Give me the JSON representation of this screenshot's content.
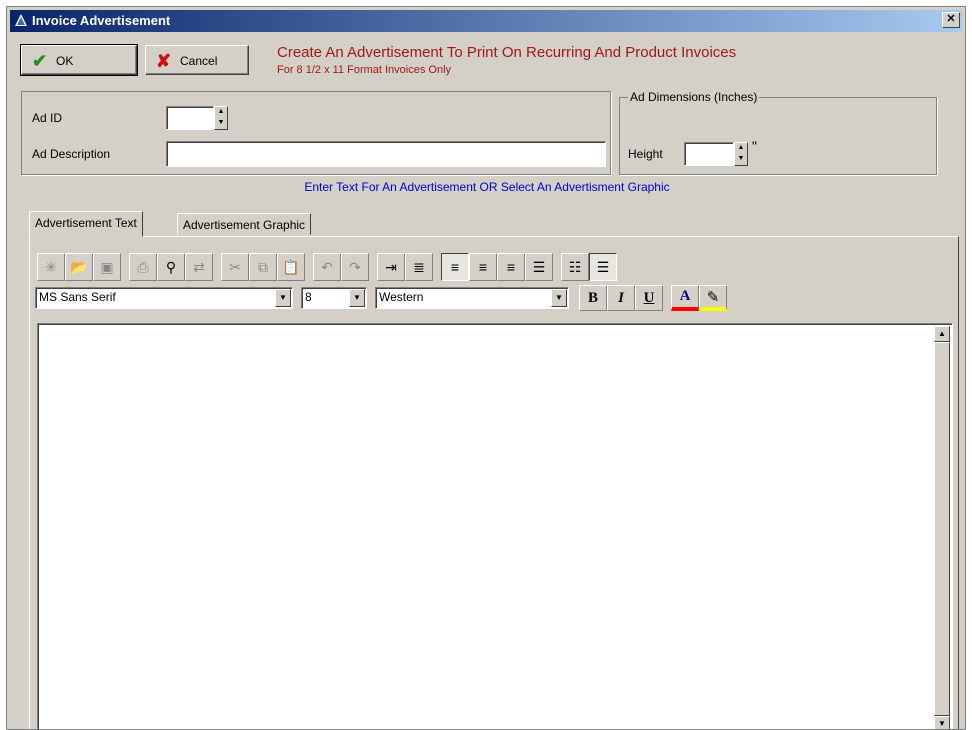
{
  "window": {
    "title": "Invoice Advertisement",
    "close_glyph": "✕"
  },
  "buttons": {
    "ok": "OK",
    "cancel": "Cancel"
  },
  "header": {
    "headline": "Create An Advertisement To Print On Recurring And Product Invoices",
    "subline": "For 8 1/2 x 11 Format Invoices Only"
  },
  "form": {
    "ad_id_label": "Ad ID",
    "ad_id_value": "",
    "ad_description_label": "Ad Description",
    "ad_description_value": "",
    "dimensions_legend": "Ad Dimensions (Inches)",
    "height_label": "Height",
    "height_value": "",
    "height_unit": "\""
  },
  "info_text": "Enter Text For An Advertisement OR Select An Advertisment Graphic",
  "tabs": [
    {
      "label": "Advertisement Text",
      "active": true
    },
    {
      "label": "Advertisement Graphic",
      "active": false
    }
  ],
  "toolbar": {
    "icons": [
      "new-icon",
      "open-folder-icon",
      "save-icon",
      "print-icon",
      "find-icon",
      "replace-icon",
      "cut-icon",
      "copy-icon",
      "paste-icon",
      "undo-icon",
      "redo-icon",
      "indent-icon",
      "justify-icon",
      "align-left-icon",
      "align-center-icon",
      "align-right-icon",
      "align-justify-icon",
      "bullet-list-icon",
      "numbered-list-icon"
    ],
    "font_name": "MS Sans Serif",
    "font_size": "8",
    "charset": "Western",
    "bold": "B",
    "italic": "I",
    "underline": "U",
    "font_color_glyph": "A",
    "highlight_glyph": "✎"
  },
  "colors": {
    "title_bar": "#0a246a",
    "headline": "#a01818",
    "info": "#0000cc",
    "font_color": "#ff0000",
    "highlight": "#ffff00"
  }
}
